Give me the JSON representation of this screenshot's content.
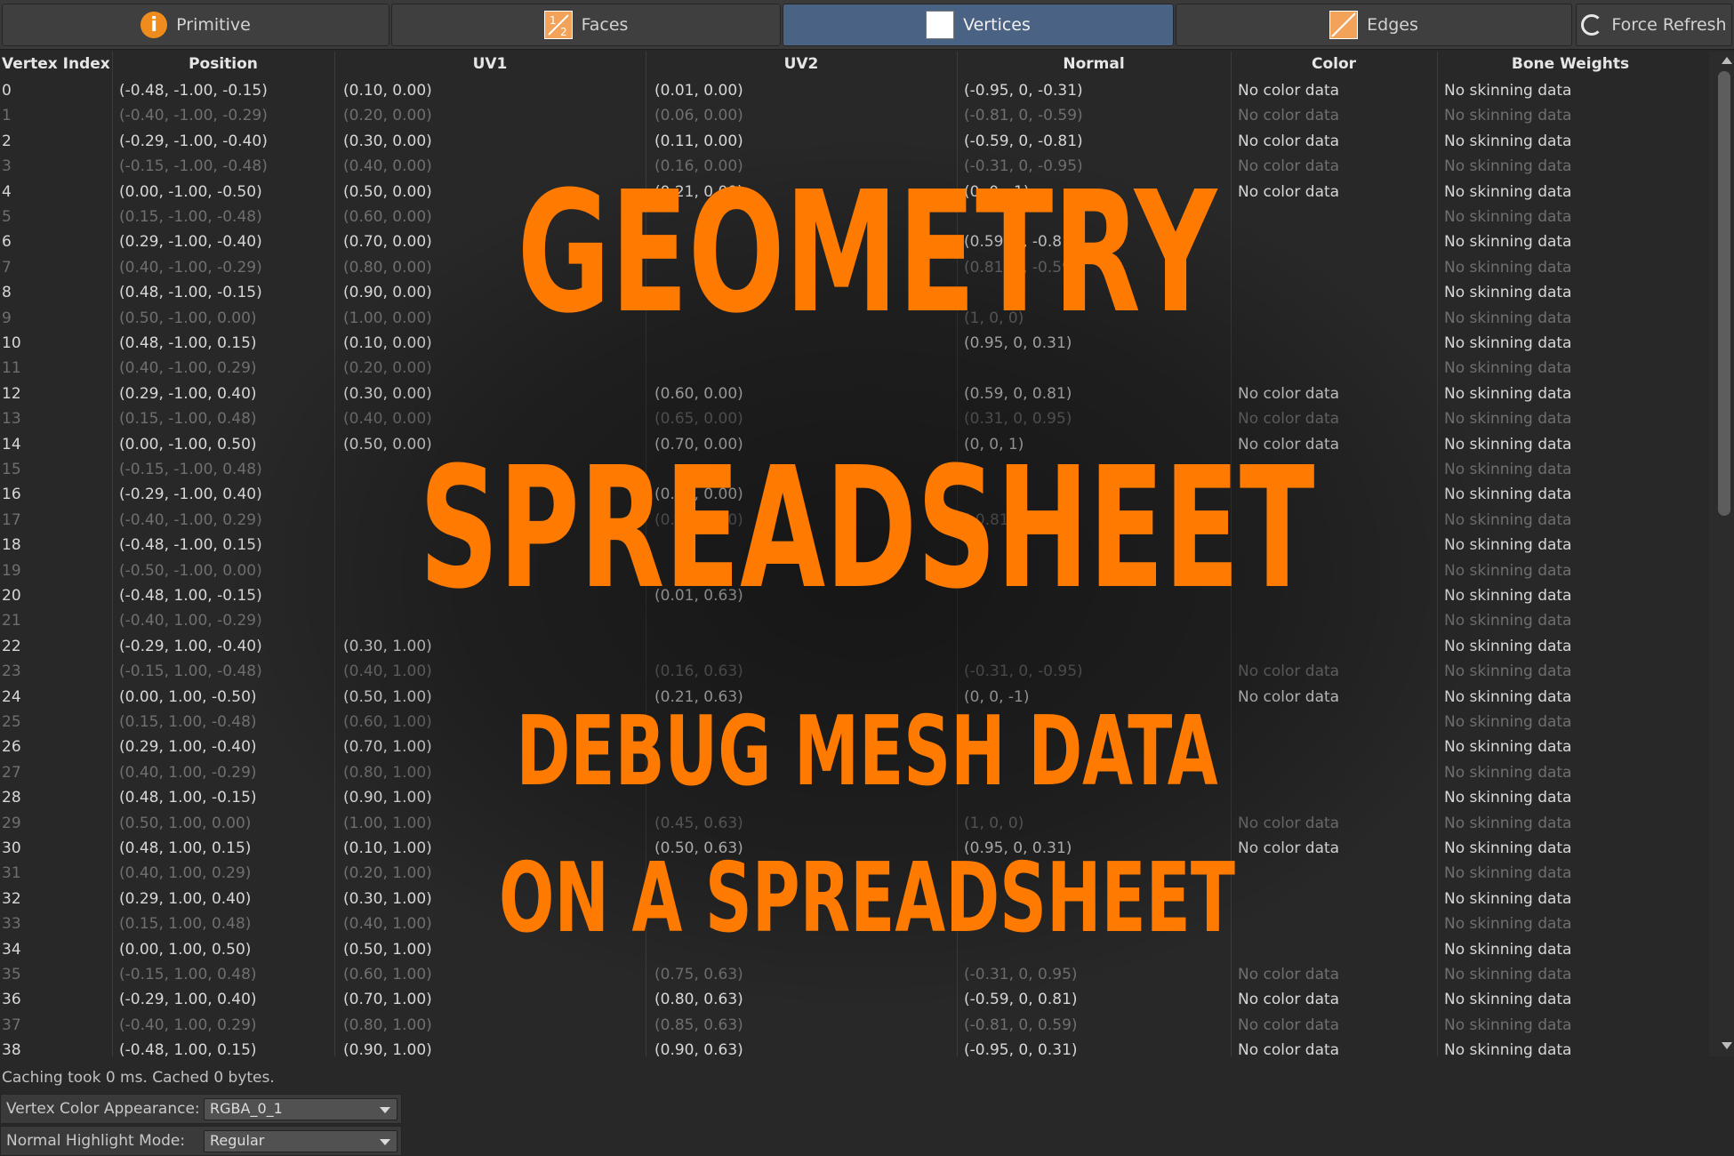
{
  "tabs": [
    {
      "label": "Primitive",
      "icon": "info-icon",
      "active": false
    },
    {
      "label": "Faces",
      "icon": "faces-icon",
      "active": false
    },
    {
      "label": "Vertices",
      "icon": "vertices-icon",
      "active": true
    },
    {
      "label": "Edges",
      "icon": "edges-icon",
      "active": false
    }
  ],
  "faces_icon_text": "1/2",
  "force_refresh_label": "Force Refresh",
  "columns": [
    "Vertex Index",
    "Position",
    "UV1",
    "UV2",
    "Normal",
    "Color",
    "Bone Weights"
  ],
  "rows": [
    [
      "0",
      "(-0.48, -1.00, -0.15)",
      "(0.10, 0.00)",
      "(0.01, 0.00)",
      "(-0.95, 0, -0.31)",
      "No color data",
      "No skinning data"
    ],
    [
      "1",
      "(-0.40, -1.00, -0.29)",
      "(0.20, 0.00)",
      "(0.06, 0.00)",
      "(-0.81, 0, -0.59)",
      "No color data",
      "No skinning data"
    ],
    [
      "2",
      "(-0.29, -1.00, -0.40)",
      "(0.30, 0.00)",
      "(0.11, 0.00)",
      "(-0.59, 0, -0.81)",
      "No color data",
      "No skinning data"
    ],
    [
      "3",
      "(-0.15, -1.00, -0.48)",
      "(0.40, 0.00)",
      "(0.16, 0.00)",
      "(-0.31, 0, -0.95)",
      "No color data",
      "No skinning data"
    ],
    [
      "4",
      "(0.00, -1.00, -0.50)",
      "(0.50, 0.00)",
      "(0.21, 0.00)",
      "(0, 0, -1)",
      "No color data",
      "No skinning data"
    ],
    [
      "5",
      "(0.15, -1.00, -0.48)",
      "(0.60, 0.00)",
      "",
      "",
      "",
      "No skinning data"
    ],
    [
      "6",
      "(0.29, -1.00, -0.40)",
      "(0.70, 0.00)",
      "",
      "(0.59, 0, -0.81)",
      "",
      "No skinning data"
    ],
    [
      "7",
      "(0.40, -1.00, -0.29)",
      "(0.80, 0.00)",
      "",
      "(0.81, 0, -0.59)",
      "",
      "No skinning data"
    ],
    [
      "8",
      "(0.48, -1.00, -0.15)",
      "(0.90, 0.00)",
      "",
      "",
      "",
      "No skinning data"
    ],
    [
      "9",
      "(0.50, -1.00, 0.00)",
      "(1.00, 0.00)",
      "",
      "(1, 0, 0)",
      "",
      "No skinning data"
    ],
    [
      "10",
      "(0.48, -1.00, 0.15)",
      "(0.10, 0.00)",
      "",
      "(0.95, 0, 0.31)",
      "",
      "No skinning data"
    ],
    [
      "11",
      "(0.40, -1.00, 0.29)",
      "(0.20, 0.00)",
      "",
      "",
      "",
      "No skinning data"
    ],
    [
      "12",
      "(0.29, -1.00, 0.40)",
      "(0.30, 0.00)",
      "(0.60, 0.00)",
      "(0.59, 0, 0.81)",
      "No color data",
      "No skinning data"
    ],
    [
      "13",
      "(0.15, -1.00, 0.48)",
      "(0.40, 0.00)",
      "(0.65, 0.00)",
      "(0.31, 0, 0.95)",
      "No color data",
      "No skinning data"
    ],
    [
      "14",
      "(0.00, -1.00, 0.50)",
      "(0.50, 0.00)",
      "(0.70, 0.00)",
      "(0, 0, 1)",
      "No color data",
      "No skinning data"
    ],
    [
      "15",
      "(-0.15, -1.00, 0.48)",
      "",
      "",
      "",
      "",
      "No skinning data"
    ],
    [
      "16",
      "(-0.29, -1.00, 0.40)",
      "",
      "(0.80, 0.00)",
      "",
      "",
      "No skinning data"
    ],
    [
      "17",
      "(-0.40, -1.00, 0.29)",
      "",
      "(0.85, 0.00)",
      "(-0.81, 0, 0.59)",
      "",
      "No skinning data"
    ],
    [
      "18",
      "(-0.48, -1.00, 0.15)",
      "",
      "",
      "",
      "",
      "No skinning data"
    ],
    [
      "19",
      "(-0.50, -1.00, 0.00)",
      "",
      "",
      "",
      "",
      "No skinning data"
    ],
    [
      "20",
      "(-0.48, 1.00, -0.15)",
      "",
      "(0.01, 0.63)",
      "",
      "",
      "No skinning data"
    ],
    [
      "21",
      "(-0.40, 1.00, -0.29)",
      "",
      "",
      "",
      "",
      "No skinning data"
    ],
    [
      "22",
      "(-0.29, 1.00, -0.40)",
      "(0.30, 1.00)",
      "",
      "",
      "",
      "No skinning data"
    ],
    [
      "23",
      "(-0.15, 1.00, -0.48)",
      "(0.40, 1.00)",
      "(0.16, 0.63)",
      "(-0.31, 0, -0.95)",
      "No color data",
      "No skinning data"
    ],
    [
      "24",
      "(0.00, 1.00, -0.50)",
      "(0.50, 1.00)",
      "(0.21, 0.63)",
      "(0, 0, -1)",
      "No color data",
      "No skinning data"
    ],
    [
      "25",
      "(0.15, 1.00, -0.48)",
      "(0.60, 1.00)",
      "",
      "",
      "",
      "No skinning data"
    ],
    [
      "26",
      "(0.29, 1.00, -0.40)",
      "(0.70, 1.00)",
      "",
      "",
      "",
      "No skinning data"
    ],
    [
      "27",
      "(0.40, 1.00, -0.29)",
      "(0.80, 1.00)",
      "",
      "",
      "",
      "No skinning data"
    ],
    [
      "28",
      "(0.48, 1.00, -0.15)",
      "(0.90, 1.00)",
      "",
      "",
      "",
      "No skinning data"
    ],
    [
      "29",
      "(0.50, 1.00, 0.00)",
      "(1.00, 1.00)",
      "(0.45, 0.63)",
      "(1, 0, 0)",
      "No color data",
      "No skinning data"
    ],
    [
      "30",
      "(0.48, 1.00, 0.15)",
      "(0.10, 1.00)",
      "(0.50, 0.63)",
      "(0.95, 0, 0.31)",
      "No color data",
      "No skinning data"
    ],
    [
      "31",
      "(0.40, 1.00, 0.29)",
      "(0.20, 1.00)",
      "",
      "",
      "",
      "No skinning data"
    ],
    [
      "32",
      "(0.29, 1.00, 0.40)",
      "(0.30, 1.00)",
      "",
      "",
      "",
      "No skinning data"
    ],
    [
      "33",
      "(0.15, 1.00, 0.48)",
      "(0.40, 1.00)",
      "",
      "",
      "",
      "No skinning data"
    ],
    [
      "34",
      "(0.00, 1.00, 0.50)",
      "(0.50, 1.00)",
      "",
      "",
      "",
      "No skinning data"
    ],
    [
      "35",
      "(-0.15, 1.00, 0.48)",
      "(0.60, 1.00)",
      "(0.75, 0.63)",
      "(-0.31, 0, 0.95)",
      "No color data",
      "No skinning data"
    ],
    [
      "36",
      "(-0.29, 1.00, 0.40)",
      "(0.70, 1.00)",
      "(0.80, 0.63)",
      "(-0.59, 0, 0.81)",
      "No color data",
      "No skinning data"
    ],
    [
      "37",
      "(-0.40, 1.00, 0.29)",
      "(0.80, 1.00)",
      "(0.85, 0.63)",
      "(-0.81, 0, 0.59)",
      "No color data",
      "No skinning data"
    ],
    [
      "38",
      "(-0.48, 1.00, 0.15)",
      "(0.90, 1.00)",
      "(0.90, 0.63)",
      "(-0.95, 0, 0.31)",
      "No color data",
      "No skinning data"
    ]
  ],
  "footer": {
    "cache_status": "Caching took 0 ms.  Cached 0 bytes.",
    "vertex_color_label": "Vertex Color Appearance:",
    "vertex_color_value": "RGBA_0_1",
    "normal_highlight_label": "Normal Highlight Mode:",
    "normal_highlight_value": "Regular"
  },
  "overlay": {
    "title_line1": "GEOMETRY",
    "title_line2": "SPREADSHEET",
    "subtitle_line1": "DEBUG MESH DATA",
    "subtitle_line2": "ON A SPREADSHEET"
  },
  "colors": {
    "accent": "#ff7a00",
    "active_tab": "#4a6384",
    "background": "#282828"
  }
}
